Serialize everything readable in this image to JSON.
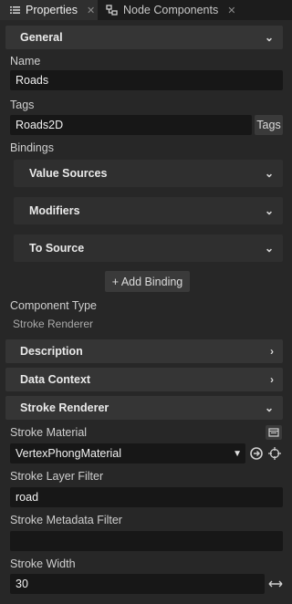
{
  "tabs": [
    {
      "label": "Properties",
      "icon": "list-icon"
    },
    {
      "label": "Node Components",
      "icon": "node-components-icon"
    }
  ],
  "general": {
    "header": "General",
    "name_label": "Name",
    "name_value": "Roads",
    "tags_label": "Tags",
    "tags_value": "Roads2D",
    "tags_button": "Tags",
    "bindings_label": "Bindings",
    "bindings": [
      "Value Sources",
      "Modifiers",
      "To Source"
    ],
    "add_binding": "+ Add Binding",
    "component_type_label": "Component Type",
    "component_type_value": "Stroke Renderer"
  },
  "sections": {
    "description": "Description",
    "data_context": "Data Context",
    "stroke_renderer": "Stroke Renderer"
  },
  "stroke": {
    "material_label": "Stroke Material",
    "material_value": "VertexPhongMaterial",
    "layer_filter_label": "Stroke Layer Filter",
    "layer_filter_value": "road",
    "metadata_filter_label": "Stroke Metadata Filter",
    "metadata_filter_value": "",
    "width_label": "Stroke Width",
    "width_value": "30"
  },
  "colors": {
    "background": "#272727",
    "header": "#353535",
    "field": "#171717"
  }
}
